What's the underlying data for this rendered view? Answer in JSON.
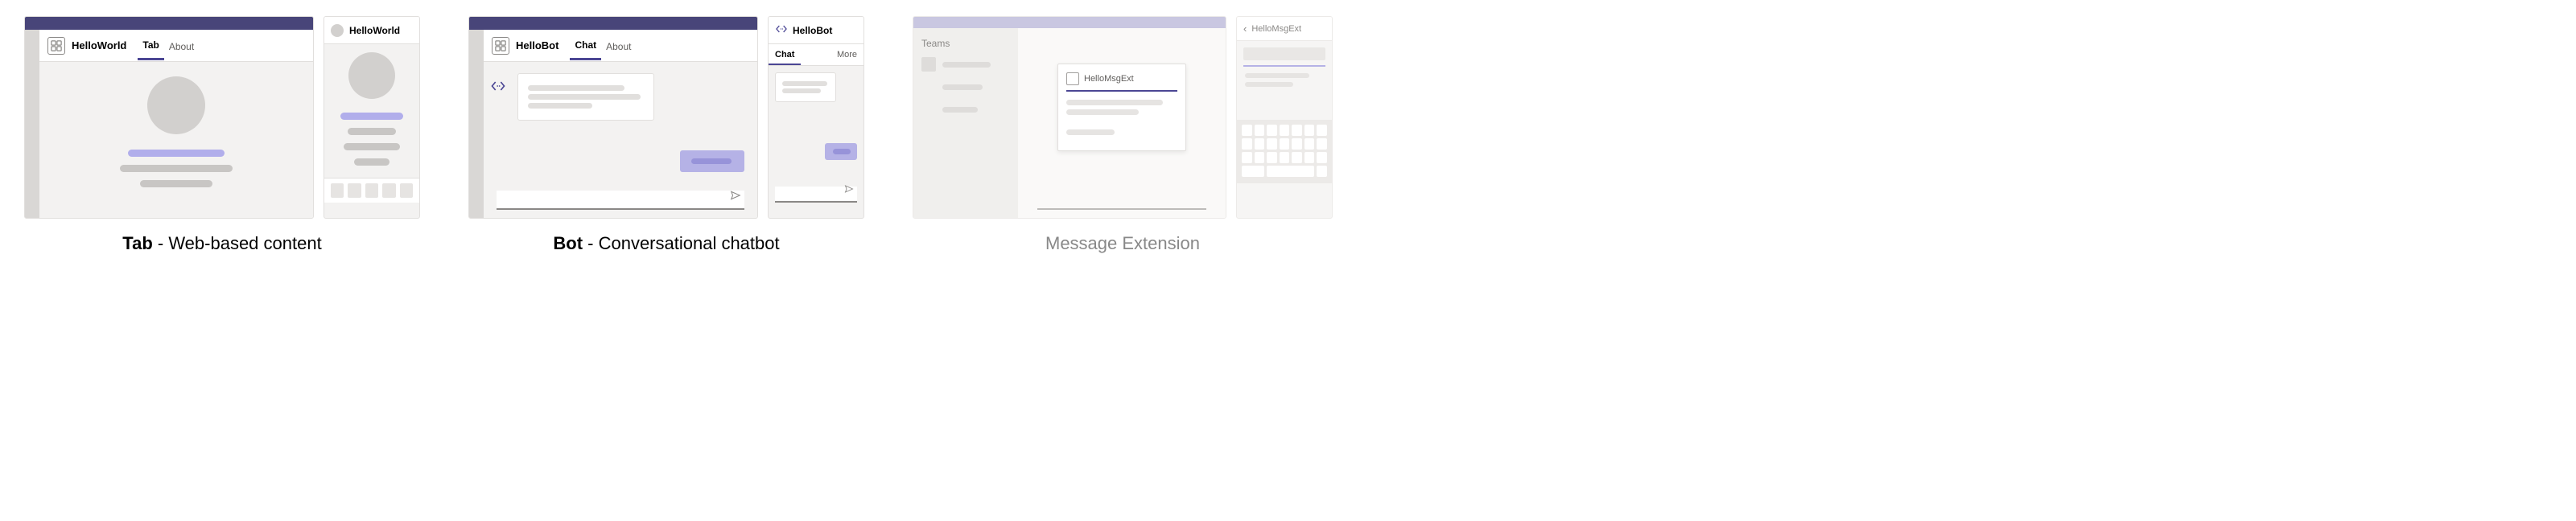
{
  "tab": {
    "caption_bold": "Tab",
    "caption_rest": " - Web-based content",
    "desktop": {
      "app_name": "HelloWorld",
      "tabs": [
        "Tab",
        "About"
      ],
      "active_tab_index": 0
    },
    "mobile": {
      "title": "HelloWorld"
    }
  },
  "bot": {
    "caption_bold": "Bot",
    "caption_rest": " - Conversational chatbot",
    "desktop": {
      "app_name": "HelloBot",
      "tabs": [
        "Chat",
        "About"
      ],
      "active_tab_index": 0
    },
    "mobile": {
      "title": "HelloBot",
      "tabs": [
        "Chat",
        "More"
      ],
      "active_tab_index": 0
    }
  },
  "me": {
    "caption": "Message Extension",
    "desktop": {
      "side_title": "Teams",
      "card_title": "HelloMsgExt"
    },
    "mobile": {
      "title": "HelloMsgExt"
    }
  }
}
